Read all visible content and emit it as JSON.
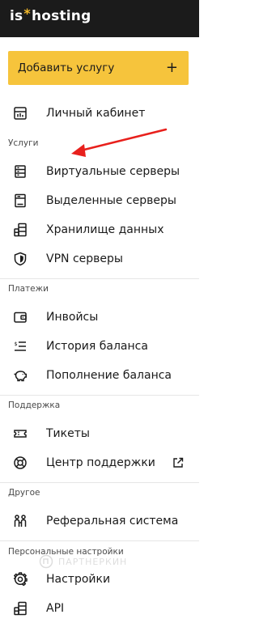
{
  "brand": {
    "part1": "is",
    "star": "*",
    "part2": "hosting",
    "accent": "#f6bb2b"
  },
  "add_service": {
    "label": "Добавить услугу",
    "icon": "+"
  },
  "menu": {
    "account": {
      "label": "Личный кабинет",
      "icon": "dashboard-icon"
    },
    "services_header": "Услуги",
    "vps": {
      "label": "Виртуальные серверы",
      "icon": "virtual-server-icon"
    },
    "dedicated": {
      "label": "Выделенные серверы",
      "icon": "dedicated-server-icon"
    },
    "storage": {
      "label": "Хранилище данных",
      "icon": "storage-icon"
    },
    "vpn": {
      "label": "VPN серверы",
      "icon": "shield-icon"
    },
    "payments_header": "Платежи",
    "invoices": {
      "label": "Инвойсы",
      "icon": "wallet-icon"
    },
    "balance_history": {
      "label": "История баланса",
      "icon": "list-icon"
    },
    "topup": {
      "label": "Пополнение баланса",
      "icon": "piggy-bank-icon"
    },
    "support_header": "Поддержка",
    "tickets": {
      "label": "Тикеты",
      "icon": "ticket-icon"
    },
    "support_center": {
      "label": "Центр поддержки",
      "icon": "lifebuoy-icon",
      "ext_icon": "external-link-icon"
    },
    "other_header": "Другое",
    "referral": {
      "label": "Реферальная система",
      "icon": "people-icon"
    },
    "personal_header": "Персональные настройки",
    "settings": {
      "label": "Настройки",
      "icon": "gear-icon"
    },
    "api": {
      "label": "API",
      "icon": "api-icon"
    }
  },
  "watermark": "ПАРТНЕРКИН",
  "annotation_color": "#e8201c"
}
